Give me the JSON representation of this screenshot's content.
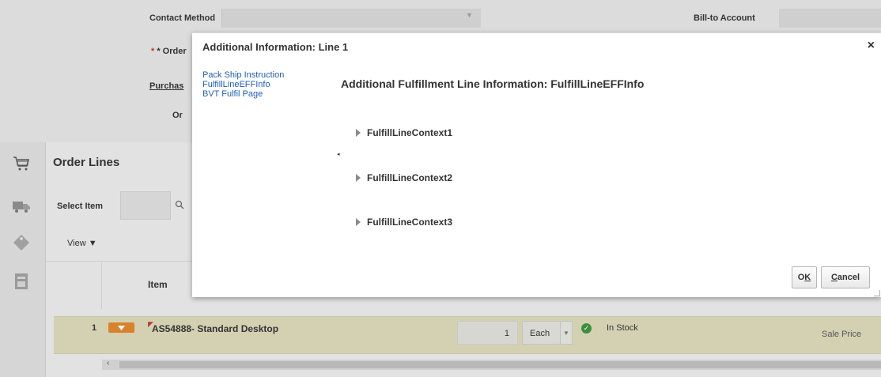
{
  "background": {
    "fields": {
      "contact_method": "Contact Method",
      "bill_to_account": "Bill-to Account",
      "order_label_fragment": "* Order",
      "purchase_label_fragment": "Purchas",
      "ord_label_fragment": "Or"
    },
    "order_lines": {
      "title": "Order Lines",
      "select_item_label": "Select Item",
      "view_menu": "View ▼",
      "item_column_header": "Item",
      "rows": [
        {
          "line_number": "1",
          "item": "AS54888- Standard Desktop",
          "quantity": "1",
          "uom": "Each",
          "availability": "In Stock",
          "price_type": "Sale Price"
        }
      ]
    }
  },
  "dialog": {
    "title": "Additional Information: Line 1",
    "close_symbol": "×",
    "nav_links": [
      "Pack Ship Instruction",
      "FulfillLineEFFInfo",
      "BVT Fulfil Page"
    ],
    "heading": "Additional Fulfillment Line Information: FulfillLineEFFInfo",
    "contexts": [
      "FulfillLineContext1",
      "FulfillLineContext2",
      "FulfillLineContext3"
    ],
    "buttons": {
      "ok_u": "K",
      "ok_prefix": "O",
      "cancel_u": "C",
      "cancel_rest": "ancel"
    }
  },
  "colors": {
    "link": "#1f5fb3",
    "row_highlight": "#d4d1b3",
    "action_orange": "#d9812b",
    "in_stock_green": "#3c8f3c"
  }
}
